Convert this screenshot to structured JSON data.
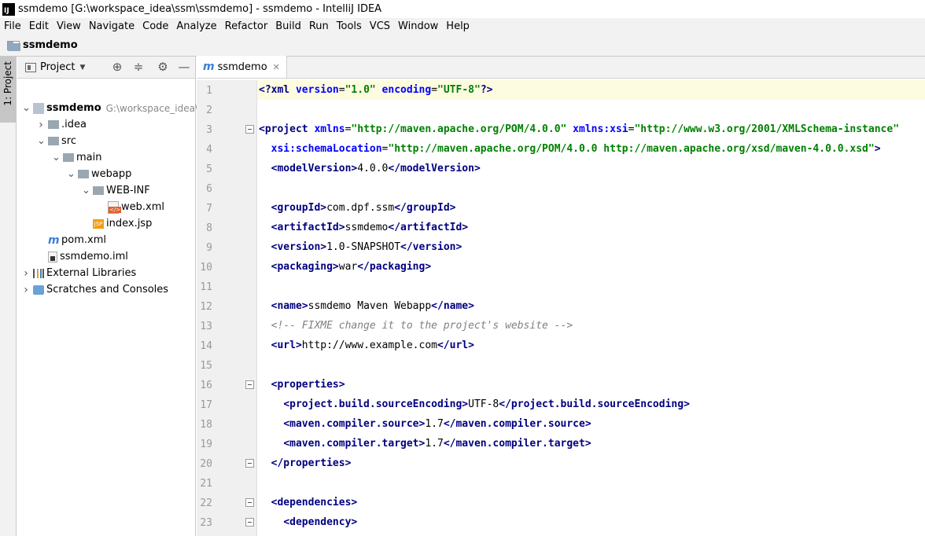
{
  "window": {
    "title": "ssmdemo [G:\\workspace_idea\\ssm\\ssmdemo] - ssmdemo - IntelliJ IDEA",
    "logo_text": "IJ"
  },
  "menu": [
    "File",
    "Edit",
    "View",
    "Navigate",
    "Code",
    "Analyze",
    "Refactor",
    "Build",
    "Run",
    "Tools",
    "VCS",
    "Window",
    "Help"
  ],
  "nav": {
    "project_name": "ssmdemo"
  },
  "side_tool": {
    "label": "1: Project"
  },
  "project_panel": {
    "header": "Project",
    "tree": [
      {
        "label": "ssmdemo",
        "path": "G:\\workspace_idea\\s",
        "icon": "module-folder-icon",
        "expanded": true
      },
      {
        "label": ".idea",
        "icon": "folder-icon",
        "expanded": false
      },
      {
        "label": "src",
        "icon": "folder-icon",
        "expanded": true
      },
      {
        "label": "main",
        "icon": "folder-icon",
        "expanded": true
      },
      {
        "label": "webapp",
        "icon": "web-folder-icon",
        "expanded": true
      },
      {
        "label": "WEB-INF",
        "icon": "folder-icon",
        "expanded": true
      },
      {
        "label": "web.xml",
        "icon": "xml-file-icon"
      },
      {
        "label": "index.jsp",
        "icon": "jsp-file-icon"
      },
      {
        "label": "pom.xml",
        "icon": "maven-icon"
      },
      {
        "label": "ssmdemo.iml",
        "icon": "iml-file-icon"
      },
      {
        "label": "External Libraries",
        "icon": "libraries-icon",
        "expanded": false
      },
      {
        "label": "Scratches and Consoles",
        "icon": "scratches-icon",
        "expanded": false
      }
    ]
  },
  "editor": {
    "tab_label": "ssmdemo",
    "line_numbers": [
      "1",
      "2",
      "3",
      "4",
      "5",
      "6",
      "7",
      "8",
      "9",
      "10",
      "11",
      "12",
      "13",
      "14",
      "15",
      "16",
      "17",
      "18",
      "19",
      "20",
      "21",
      "22",
      "23"
    ],
    "lines": [
      [
        {
          "t": "<?",
          "c": "tg"
        },
        {
          "t": "xml ",
          "c": "tg"
        },
        {
          "t": "version",
          "c": "at"
        },
        {
          "t": "=",
          "c": "tx"
        },
        {
          "t": "\"1.0\"",
          "c": "av"
        },
        {
          "t": " encoding",
          "c": "at"
        },
        {
          "t": "=",
          "c": "tx"
        },
        {
          "t": "\"UTF-8\"",
          "c": "av"
        },
        {
          "t": "?>",
          "c": "tg"
        }
      ],
      [],
      [
        {
          "t": "<project ",
          "c": "tg"
        },
        {
          "t": "xmlns",
          "c": "at"
        },
        {
          "t": "=",
          "c": "tx"
        },
        {
          "t": "\"http://maven.apache.org/POM/4.0.0\"",
          "c": "av"
        },
        {
          "t": " xmlns:xsi",
          "c": "at"
        },
        {
          "t": "=",
          "c": "tx"
        },
        {
          "t": "\"http://www.w3.org/2001/XMLSchema-instance\"",
          "c": "av"
        }
      ],
      [
        {
          "t": "  xsi:schemaLocation",
          "c": "at"
        },
        {
          "t": "=",
          "c": "tx"
        },
        {
          "t": "\"http://maven.apache.org/POM/4.0.0 http://maven.apache.org/xsd/maven-4.0.0.xsd\"",
          "c": "av"
        },
        {
          "t": ">",
          "c": "tg"
        }
      ],
      [
        {
          "t": "  "
        },
        {
          "t": "<modelVersion>",
          "c": "tg"
        },
        {
          "t": "4.0.0",
          "c": "tx"
        },
        {
          "t": "</modelVersion>",
          "c": "tg"
        }
      ],
      [],
      [
        {
          "t": "  "
        },
        {
          "t": "<groupId>",
          "c": "tg"
        },
        {
          "t": "com.dpf.ssm",
          "c": "tx"
        },
        {
          "t": "</groupId>",
          "c": "tg"
        }
      ],
      [
        {
          "t": "  "
        },
        {
          "t": "<artifactId>",
          "c": "tg"
        },
        {
          "t": "ssmdemo",
          "c": "tx"
        },
        {
          "t": "</artifactId>",
          "c": "tg"
        }
      ],
      [
        {
          "t": "  "
        },
        {
          "t": "<version>",
          "c": "tg"
        },
        {
          "t": "1.0-SNAPSHOT",
          "c": "tx"
        },
        {
          "t": "</version>",
          "c": "tg"
        }
      ],
      [
        {
          "t": "  "
        },
        {
          "t": "<packaging>",
          "c": "tg"
        },
        {
          "t": "war",
          "c": "tx"
        },
        {
          "t": "</packaging>",
          "c": "tg"
        }
      ],
      [],
      [
        {
          "t": "  "
        },
        {
          "t": "<name>",
          "c": "tg"
        },
        {
          "t": "ssmdemo Maven Webapp",
          "c": "tx"
        },
        {
          "t": "</name>",
          "c": "tg"
        }
      ],
      [
        {
          "t": "  "
        },
        {
          "t": "<!-- FIXME change it to the project's website -->",
          "c": "cm"
        }
      ],
      [
        {
          "t": "  "
        },
        {
          "t": "<url>",
          "c": "tg"
        },
        {
          "t": "http://www.example.com",
          "c": "tx"
        },
        {
          "t": "</url>",
          "c": "tg"
        }
      ],
      [],
      [
        {
          "t": "  "
        },
        {
          "t": "<properties>",
          "c": "tg"
        }
      ],
      [
        {
          "t": "    "
        },
        {
          "t": "<project.build.sourceEncoding>",
          "c": "tg"
        },
        {
          "t": "UTF-8",
          "c": "tx"
        },
        {
          "t": "</project.build.sourceEncoding>",
          "c": "tg"
        }
      ],
      [
        {
          "t": "    "
        },
        {
          "t": "<maven.compiler.source>",
          "c": "tg"
        },
        {
          "t": "1.7",
          "c": "tx"
        },
        {
          "t": "</maven.compiler.source>",
          "c": "tg"
        }
      ],
      [
        {
          "t": "    "
        },
        {
          "t": "<maven.compiler.target>",
          "c": "tg"
        },
        {
          "t": "1.7",
          "c": "tx"
        },
        {
          "t": "</maven.compiler.target>",
          "c": "tg"
        }
      ],
      [
        {
          "t": "  "
        },
        {
          "t": "</properties>",
          "c": "tg"
        }
      ],
      [],
      [
        {
          "t": "  "
        },
        {
          "t": "<dependencies>",
          "c": "tg"
        }
      ],
      [
        {
          "t": "    "
        },
        {
          "t": "<dependency>",
          "c": "tg"
        }
      ]
    ]
  }
}
